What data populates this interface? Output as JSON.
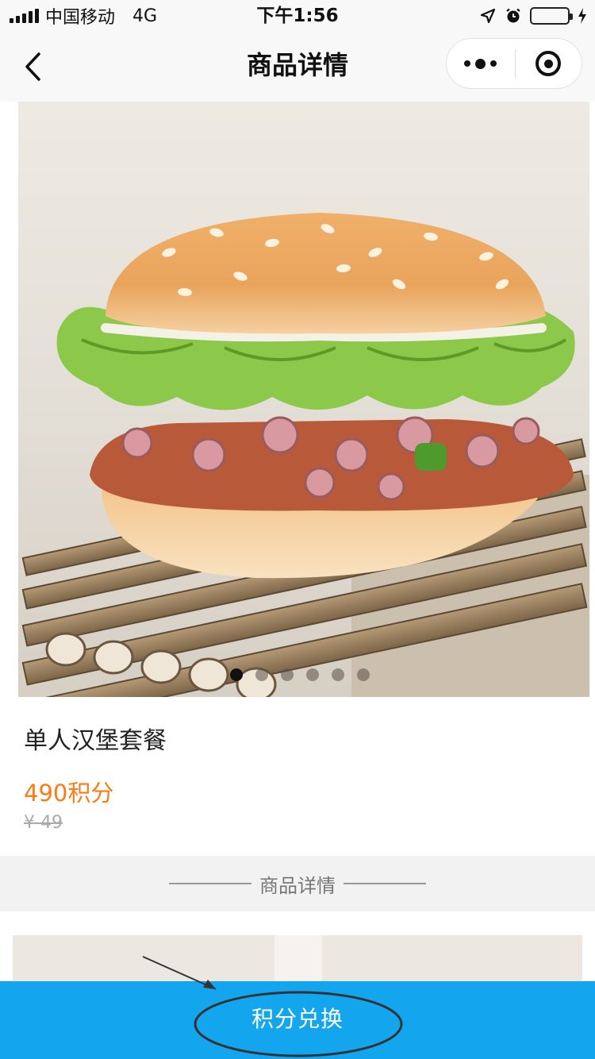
{
  "status_bar": {
    "carrier": "中国移动",
    "network": "4G",
    "time": "下午1:56"
  },
  "nav": {
    "title": "商品详情"
  },
  "product": {
    "name": "单人汉堡套餐",
    "points_price": "490积分",
    "original_price": "¥ 49",
    "carousel": {
      "slides": 6,
      "active_index": 0
    }
  },
  "detail": {
    "section_label": "商品详情"
  },
  "action": {
    "exchange_label": "积分兑换"
  },
  "colors": {
    "accent": "#13a6ef",
    "price": "#ff7a14",
    "battery": "#4cd964"
  },
  "icons": [
    "signal-icon",
    "location-icon",
    "alarm-icon",
    "battery-icon",
    "charging-icon",
    "back-arrow-icon",
    "more-icon",
    "close-target-icon"
  ]
}
